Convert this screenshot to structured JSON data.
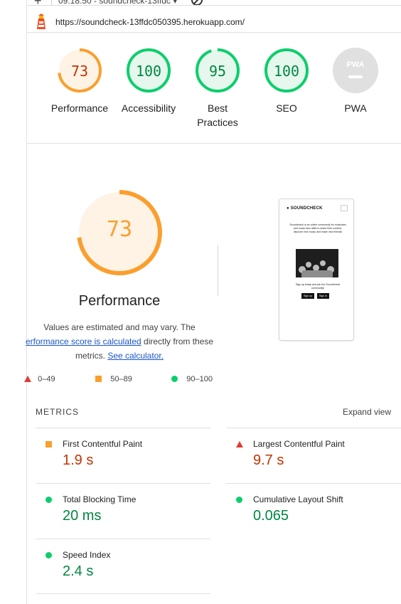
{
  "browser": {
    "session_title": "09:18:50 - soundcheck-13ffdc",
    "url": "https://soundcheck-13ffdc050395.herokuapp.com/"
  },
  "colors": {
    "pass": "#0cce6b",
    "average": "#fa9f2e",
    "fail": "#e03c36",
    "pass_text": "#018642",
    "fail_text": "#c33300"
  },
  "gauges": [
    {
      "label": "Performance",
      "score": "73",
      "value": 0.73,
      "status": "average"
    },
    {
      "label": "Accessibility",
      "score": "100",
      "value": 1.0,
      "status": "pass"
    },
    {
      "label": "Best Practices",
      "score": "95",
      "value": 0.95,
      "status": "pass"
    },
    {
      "label": "SEO",
      "score": "100",
      "value": 1.0,
      "status": "pass"
    },
    {
      "label": "PWA",
      "badge": "PWA",
      "status": "na"
    }
  ],
  "performance": {
    "score": "73",
    "value": 0.73,
    "title": "Performance",
    "disclaimer_pre": "Values are estimated and may vary. The",
    "disclaimer_link": "erformance score is calculated",
    "disclaimer_mid": " directly from these metrics. ",
    "calculator_link": "See calculator."
  },
  "screenshot": {
    "brand": "SOUNDCHECK",
    "tagline": "Soundcheck is an online community for musicians and music fans alike to share their content, discover new music and make new friends!",
    "cta": "Sign up today and join the Soundcheck community!",
    "signup": "Sign up",
    "signin": "Sign in"
  },
  "legend": [
    {
      "shape": "triangle",
      "range": "0–49"
    },
    {
      "shape": "square",
      "range": "50–89"
    },
    {
      "shape": "circle",
      "range": "90–100"
    }
  ],
  "metrics": {
    "heading": "METRICS",
    "expand": "Expand view",
    "items": [
      {
        "name": "First Contentful Paint",
        "value": "1.9 s",
        "status": "average"
      },
      {
        "name": "Largest Contentful Paint",
        "value": "9.7 s",
        "status": "fail"
      },
      {
        "name": "Total Blocking Time",
        "value": "20 ms",
        "status": "pass"
      },
      {
        "name": "Cumulative Layout Shift",
        "value": "0.065",
        "status": "pass"
      },
      {
        "name": "Speed Index",
        "value": "2.4 s",
        "status": "pass"
      }
    ]
  }
}
